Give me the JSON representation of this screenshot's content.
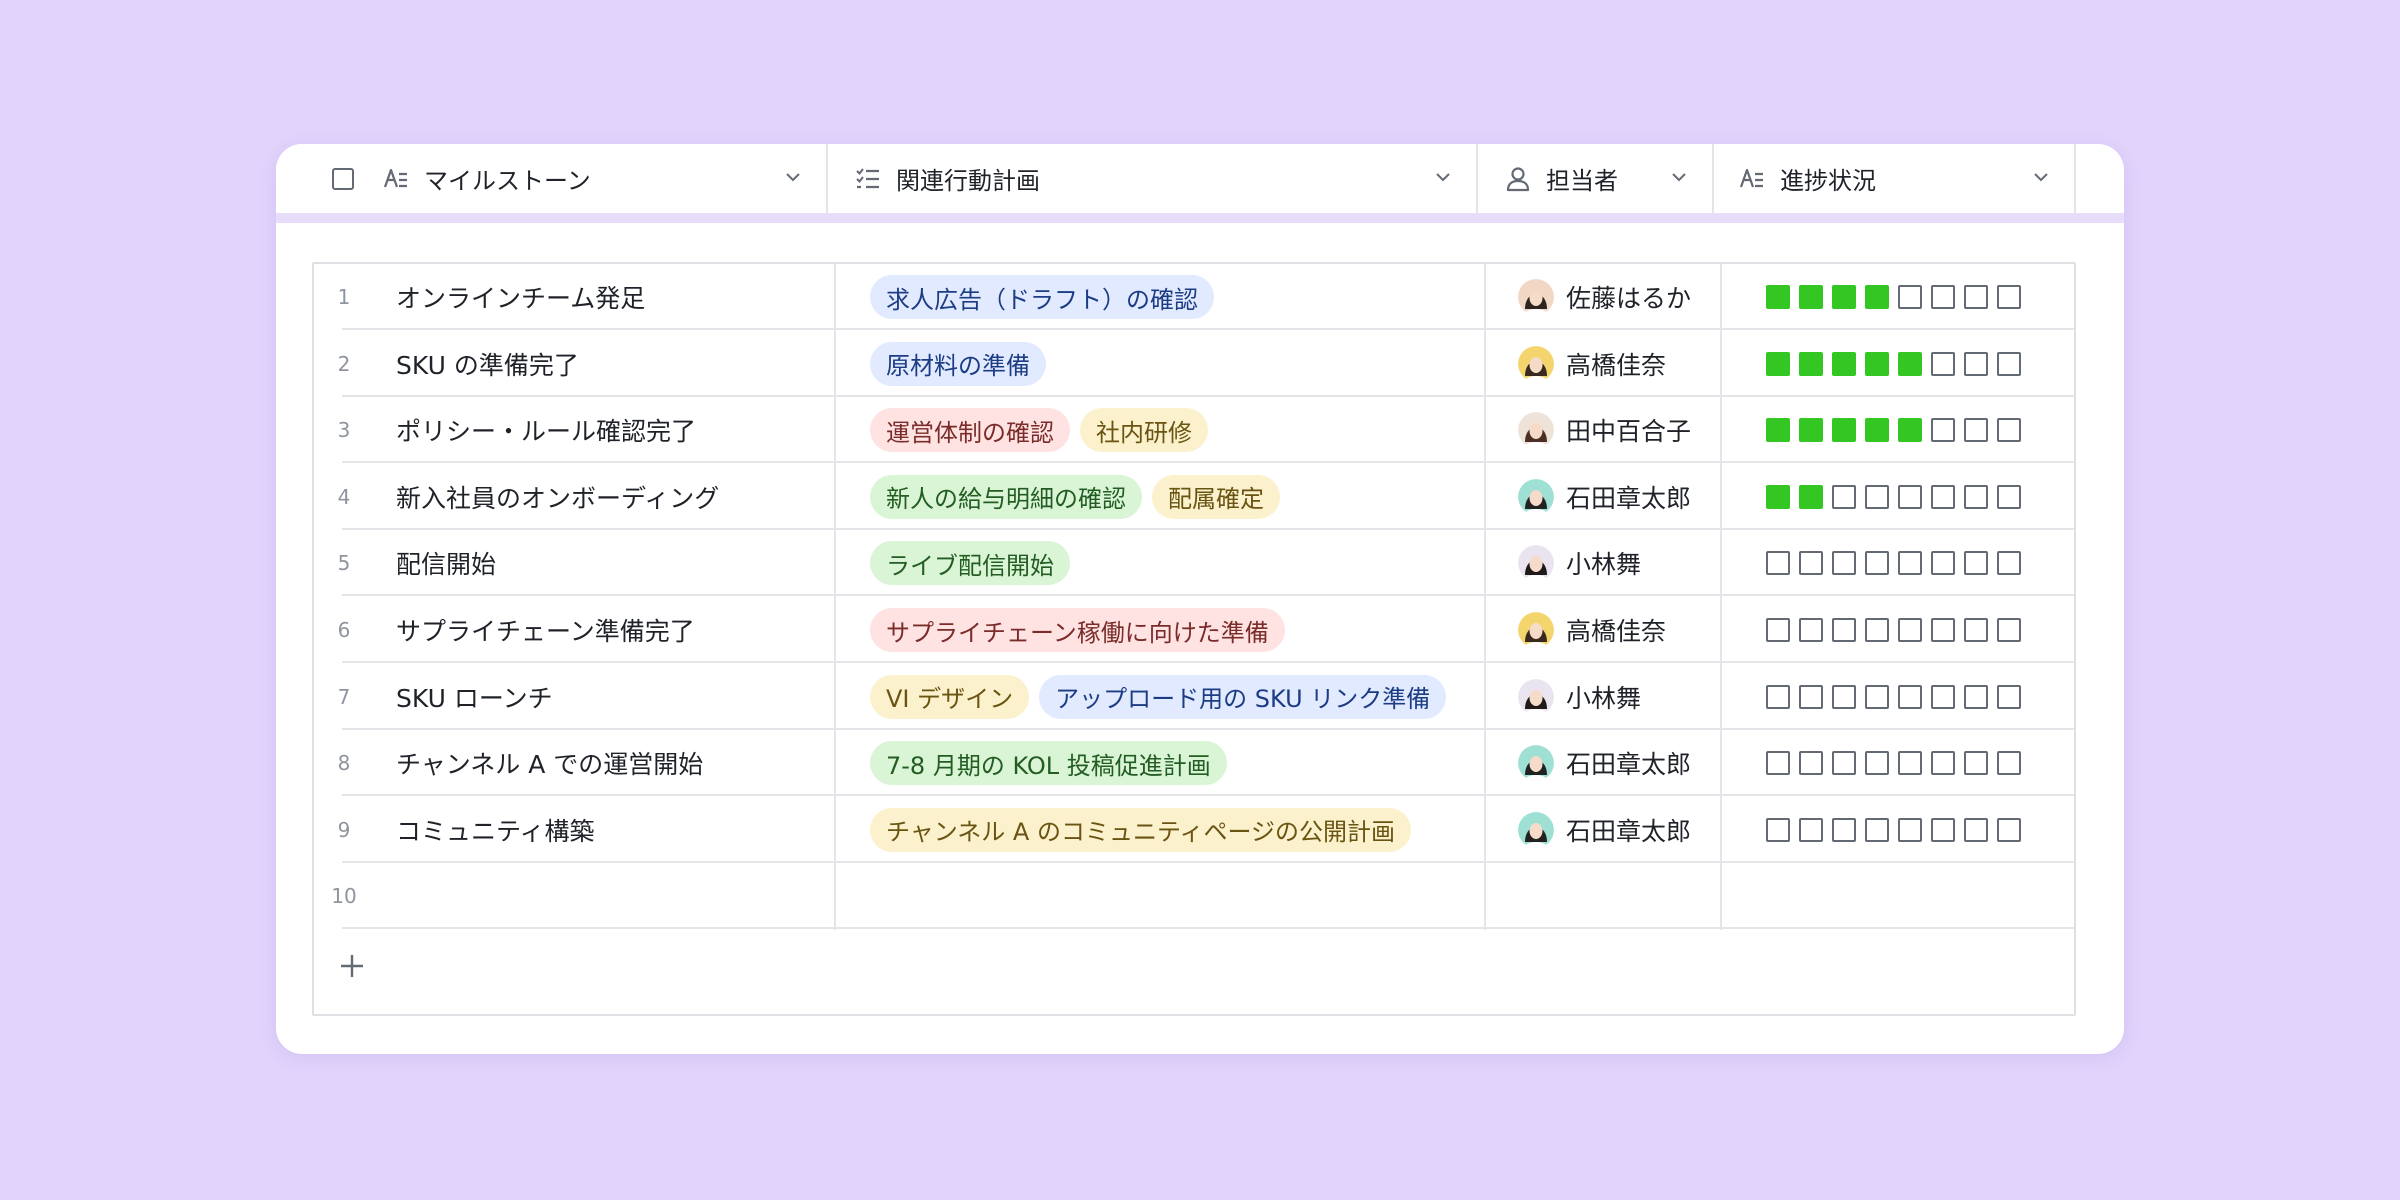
{
  "header": {
    "columns": [
      {
        "label": "マイルストーン",
        "icon": "text-field-icon"
      },
      {
        "label": "関連行動計画",
        "icon": "checklist-icon"
      },
      {
        "label": "担当者",
        "icon": "person-icon"
      },
      {
        "label": "進捗状況",
        "icon": "text-field-icon"
      }
    ]
  },
  "colors": {
    "progress_on": "#34c724",
    "tag_blue": "#e1eaff",
    "tag_red": "#fee3e2",
    "tag_yellow": "#fbf1cc",
    "tag_green": "#d9f5d6"
  },
  "rows": [
    {
      "num": "1",
      "milestone": "オンラインチーム発足",
      "actions": [
        {
          "text": "求人広告（ドラフト）の確認",
          "color": "blue"
        }
      ],
      "owner": "佐藤はるか",
      "progress": 4,
      "progress_total": 8
    },
    {
      "num": "2",
      "milestone": "SKU の準備完了",
      "actions": [
        {
          "text": "原材料の準備",
          "color": "blue"
        }
      ],
      "owner": "高橋佳奈",
      "progress": 5,
      "progress_total": 8
    },
    {
      "num": "3",
      "milestone": "ポリシー・ルール確認完了",
      "actions": [
        {
          "text": "運営体制の確認",
          "color": "red"
        },
        {
          "text": "社内研修",
          "color": "yellow"
        }
      ],
      "owner": "田中百合子",
      "progress": 5,
      "progress_total": 8
    },
    {
      "num": "4",
      "milestone": "新入社員のオンボーディング",
      "actions": [
        {
          "text": "新人の給与明細の確認",
          "color": "green"
        },
        {
          "text": "配属確定",
          "color": "yellow"
        }
      ],
      "owner": "石田章太郎",
      "progress": 2,
      "progress_total": 8
    },
    {
      "num": "5",
      "milestone": "配信開始",
      "actions": [
        {
          "text": "ライブ配信開始",
          "color": "green"
        }
      ],
      "owner": "小林舞",
      "progress": 0,
      "progress_total": 8
    },
    {
      "num": "6",
      "milestone": "サプライチェーン準備完了",
      "actions": [
        {
          "text": "サプライチェーン稼働に向けた準備",
          "color": "red"
        }
      ],
      "owner": "高橋佳奈",
      "progress": 0,
      "progress_total": 8
    },
    {
      "num": "7",
      "milestone": "SKU ローンチ",
      "actions": [
        {
          "text": "VI デザイン",
          "color": "yellow"
        },
        {
          "text": "アップロード用の SKU リンク準備",
          "color": "blue"
        }
      ],
      "owner": "小林舞",
      "progress": 0,
      "progress_total": 8
    },
    {
      "num": "8",
      "milestone": "チャンネル A での運営開始",
      "actions": [
        {
          "text": "7-8 月期の KOL 投稿促進計画",
          "color": "green"
        }
      ],
      "owner": "石田章太郎",
      "progress": 0,
      "progress_total": 8
    },
    {
      "num": "9",
      "milestone": "コミュニティ構築",
      "actions": [
        {
          "text": "チャンネル A のコミュニティページの公開計画",
          "color": "yellow"
        }
      ],
      "owner": "石田章太郎",
      "progress": 0,
      "progress_total": 8
    },
    {
      "num": "10",
      "milestone": "",
      "actions": [],
      "owner": "",
      "progress": 0,
      "progress_total": 0
    }
  ]
}
